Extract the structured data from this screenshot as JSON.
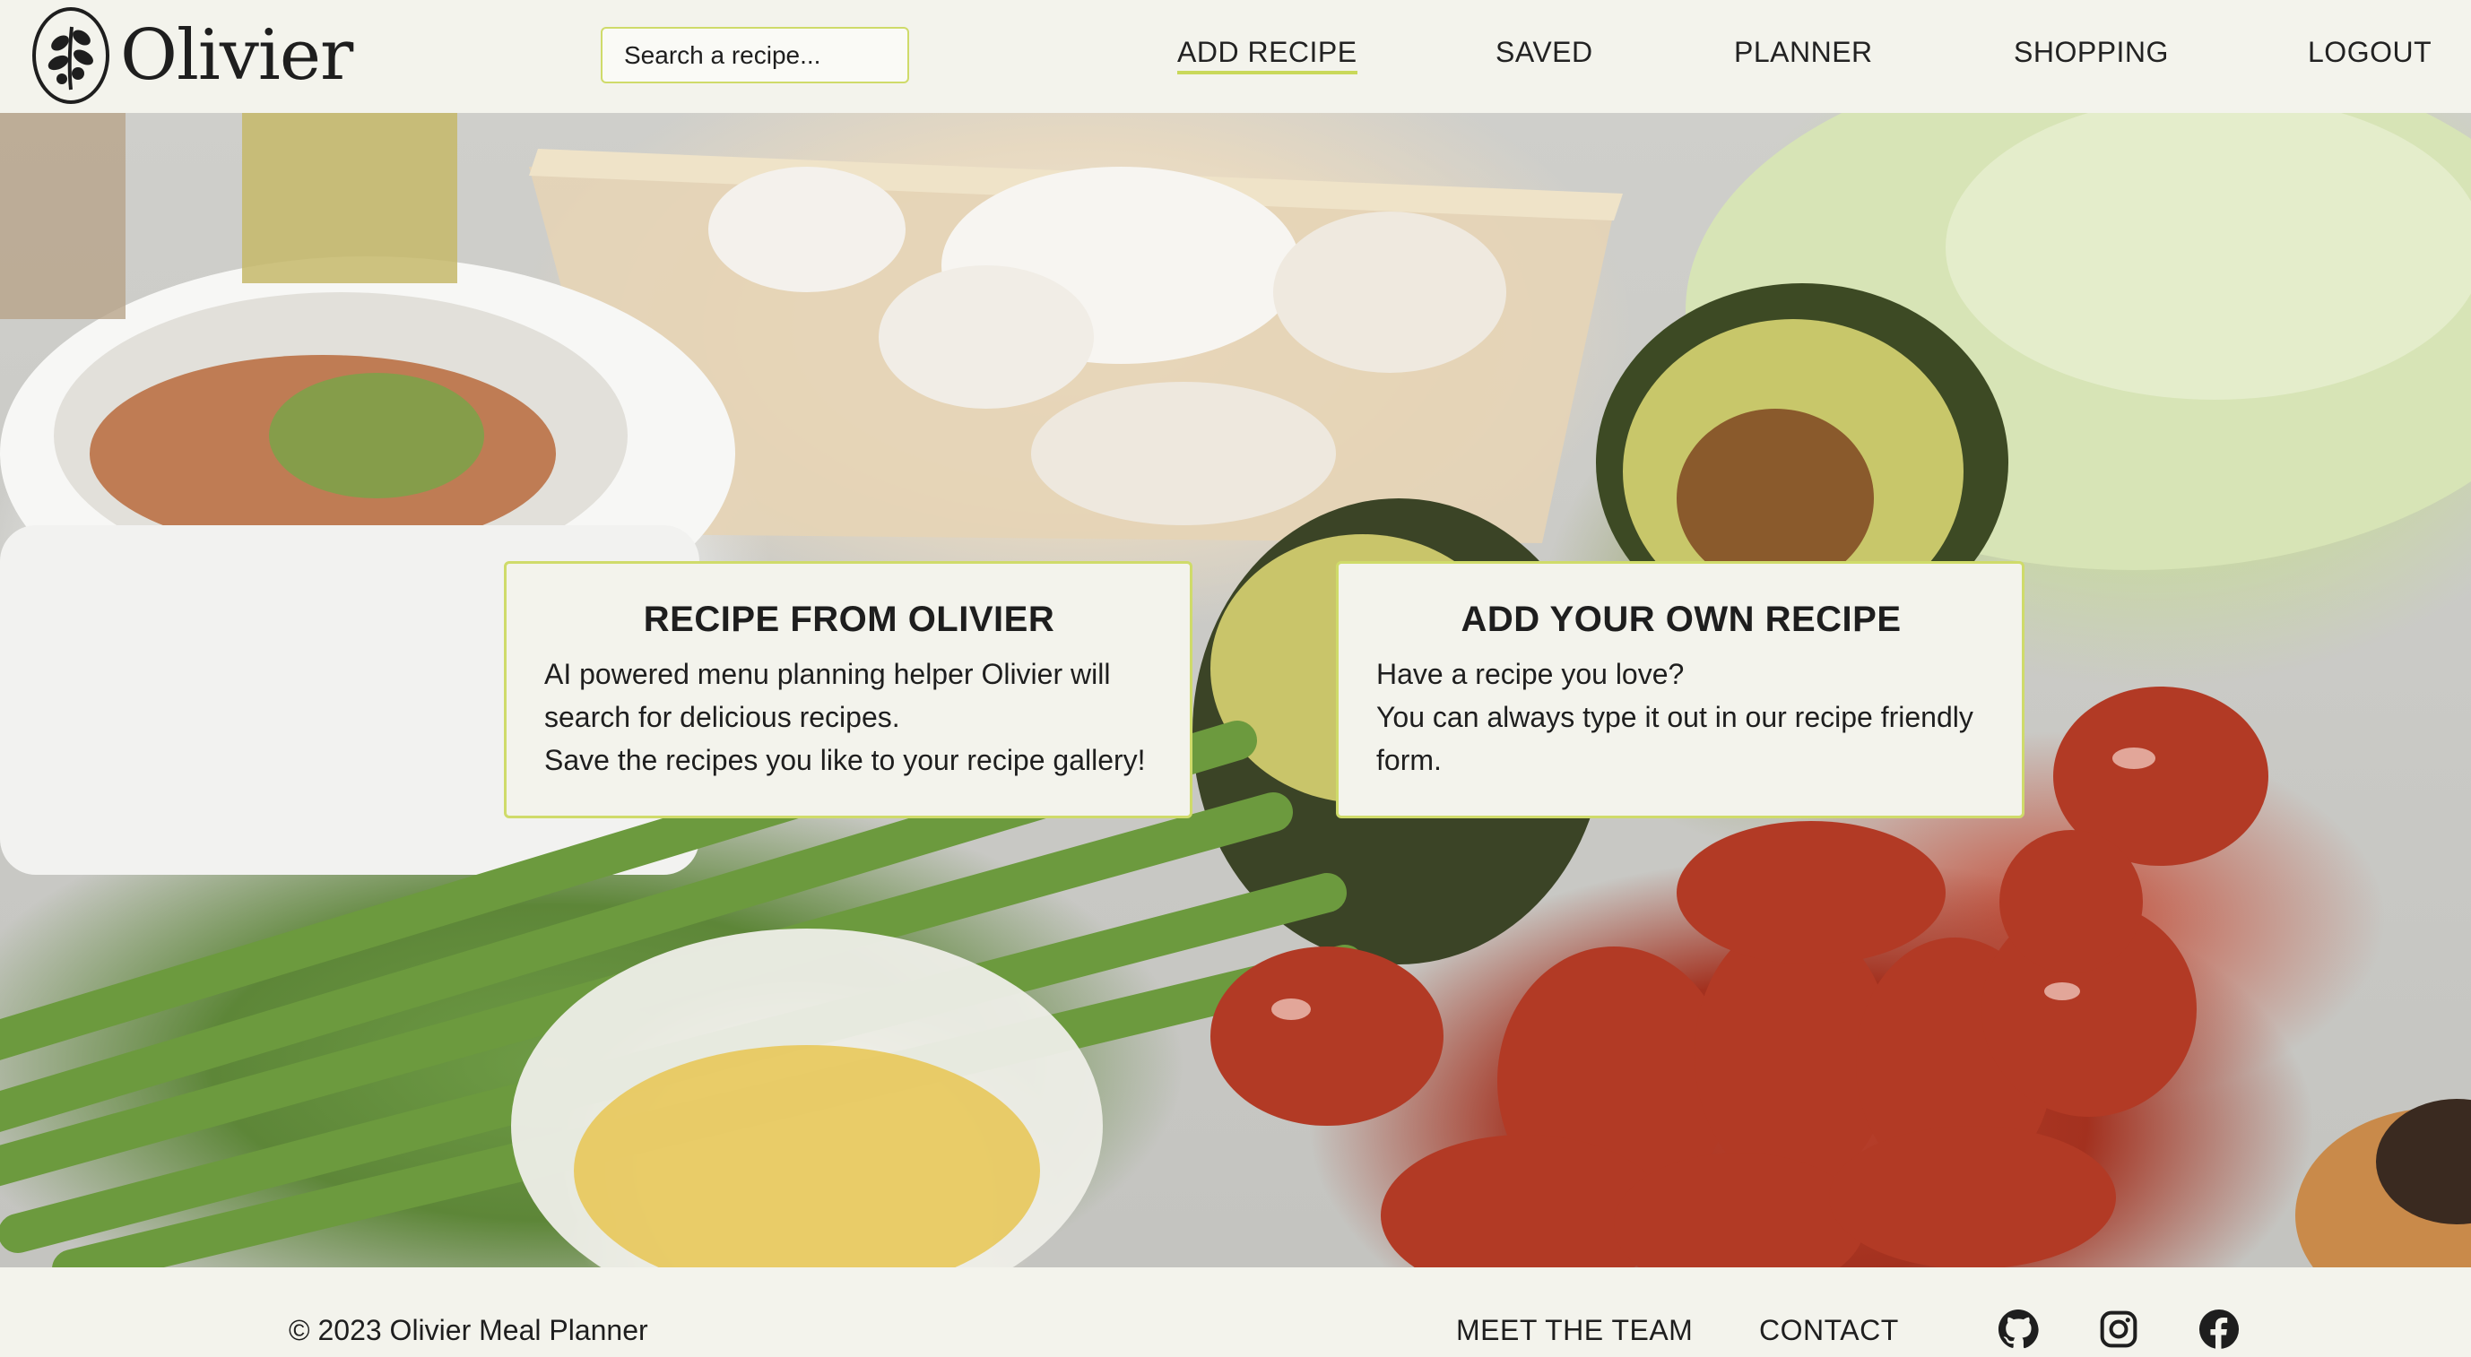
{
  "header": {
    "brand": "Olivier",
    "search_placeholder": "Search a recipe...",
    "nav": [
      {
        "label": "ADD RECIPE",
        "active": true
      },
      {
        "label": "SAVED"
      },
      {
        "label": "PLANNER"
      },
      {
        "label": "SHOPPING"
      },
      {
        "label": "LOGOUT"
      }
    ]
  },
  "cards": [
    {
      "title": "RECIPE FROM OLIVIER",
      "lines": [
        "AI powered menu planning helper Olivier will",
        "search for delicious recipes.",
        "Save the recipes you like to your recipe gallery!"
      ]
    },
    {
      "title": "ADD YOUR OWN RECIPE",
      "lines": [
        "Have a recipe you love?",
        "You can always type it out in our recipe friendly",
        "form."
      ]
    }
  ],
  "footer": {
    "copyright": "© 2023 Olivier Meal Planner",
    "links": [
      "MEET THE TEAM",
      "CONTACT"
    ],
    "social_icons": [
      "github-icon",
      "instagram-icon",
      "facebook-icon"
    ]
  },
  "colors": {
    "background": "#f3f3ec",
    "accent": "#cfdb6a",
    "text": "#1e1e1e"
  }
}
